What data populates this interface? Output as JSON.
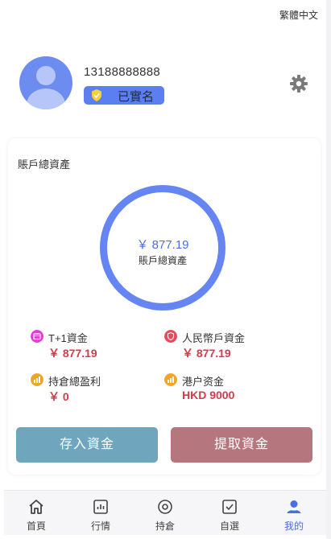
{
  "header": {
    "language_toggle": "繁體中文"
  },
  "profile": {
    "phone": "13188888888",
    "verified_badge": "已實名"
  },
  "account": {
    "title": "賬戶總資產",
    "ring_amount": "￥ 877.19",
    "ring_label": "賬戶總資產",
    "funds": [
      {
        "label": "T+1資金",
        "value": "￥ 877.19",
        "icon": "wallet-icon",
        "color": "#e23bd8"
      },
      {
        "label": "人民幣戶資金",
        "value": "￥ 877.19",
        "icon": "shield-icon",
        "color": "#e64a5c"
      },
      {
        "label": "持倉總盈利",
        "value": "￥ 0",
        "icon": "chart-icon",
        "color": "#f0a623"
      },
      {
        "label": "港户资金",
        "value": "HKD 9000",
        "icon": "chart-icon",
        "color": "#f0a623"
      }
    ]
  },
  "actions": {
    "deposit": "存入資金",
    "withdraw": "提取資金"
  },
  "tabs": [
    {
      "label": "首頁",
      "icon": "home-icon"
    },
    {
      "label": "行情",
      "icon": "market-icon"
    },
    {
      "label": "持倉",
      "icon": "position-icon"
    },
    {
      "label": "自選",
      "icon": "watchlist-icon"
    },
    {
      "label": "我的",
      "icon": "profile-icon",
      "active": true
    }
  ],
  "colors": {
    "accent": "#5b7ff0",
    "value_red": "#d43a4a",
    "deposit": "#6fa6be",
    "withdraw": "#b5767d"
  }
}
